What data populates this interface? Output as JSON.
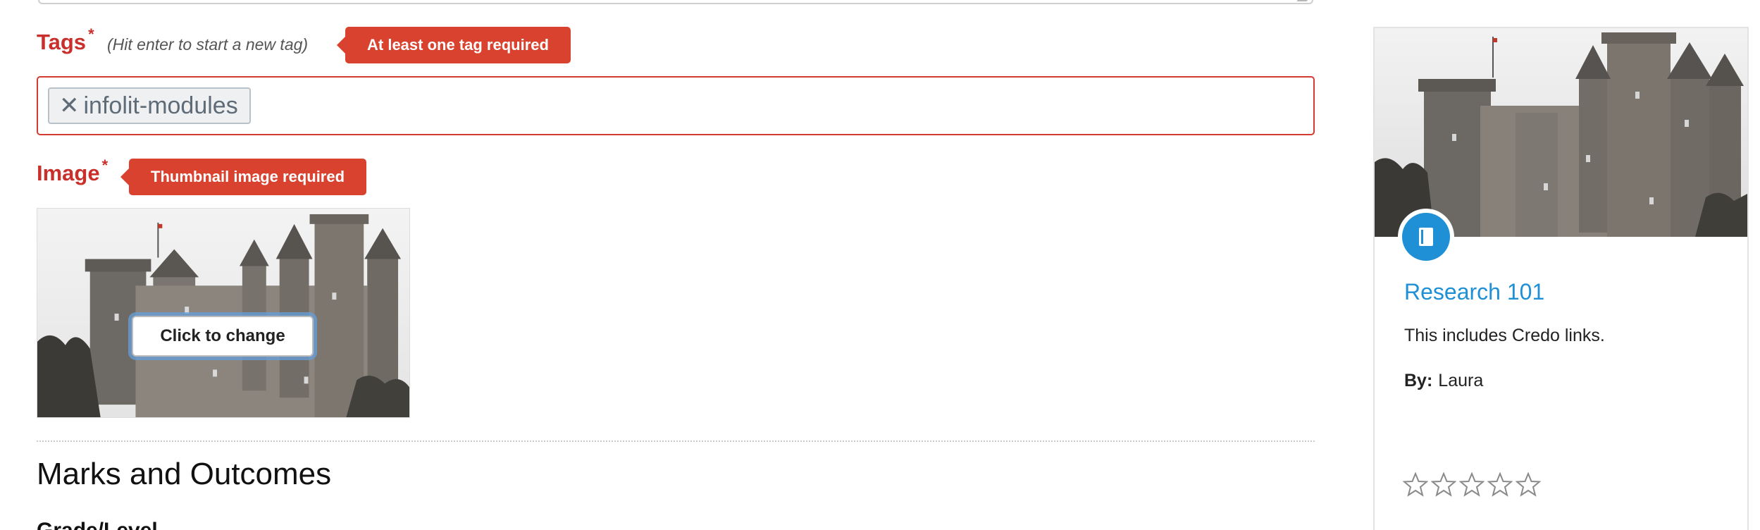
{
  "form": {
    "tags": {
      "label": "Tags",
      "required_mark": "*",
      "hint": "(Hit enter to start a new tag)",
      "error": "At least one tag required",
      "chips": [
        {
          "remove_glyph": "✕",
          "label": "infolit-modules"
        }
      ]
    },
    "image": {
      "label": "Image",
      "required_mark": "*",
      "error": "Thumbnail image required",
      "change_button": "Click to change"
    },
    "marks_section": {
      "heading": "Marks and Outcomes",
      "sub_heading": "Grade/Level"
    }
  },
  "preview_card": {
    "title": "Research 101",
    "description": "This includes Credo links.",
    "by_label": "By:",
    "author": "Laura",
    "rating": {
      "value": 0,
      "max": 5
    },
    "badge_icon": "book-icon"
  },
  "colors": {
    "error_red": "#d9422f",
    "label_red": "#c9302c",
    "link_blue": "#1f8fd6",
    "chip_text": "#5f6b76"
  }
}
